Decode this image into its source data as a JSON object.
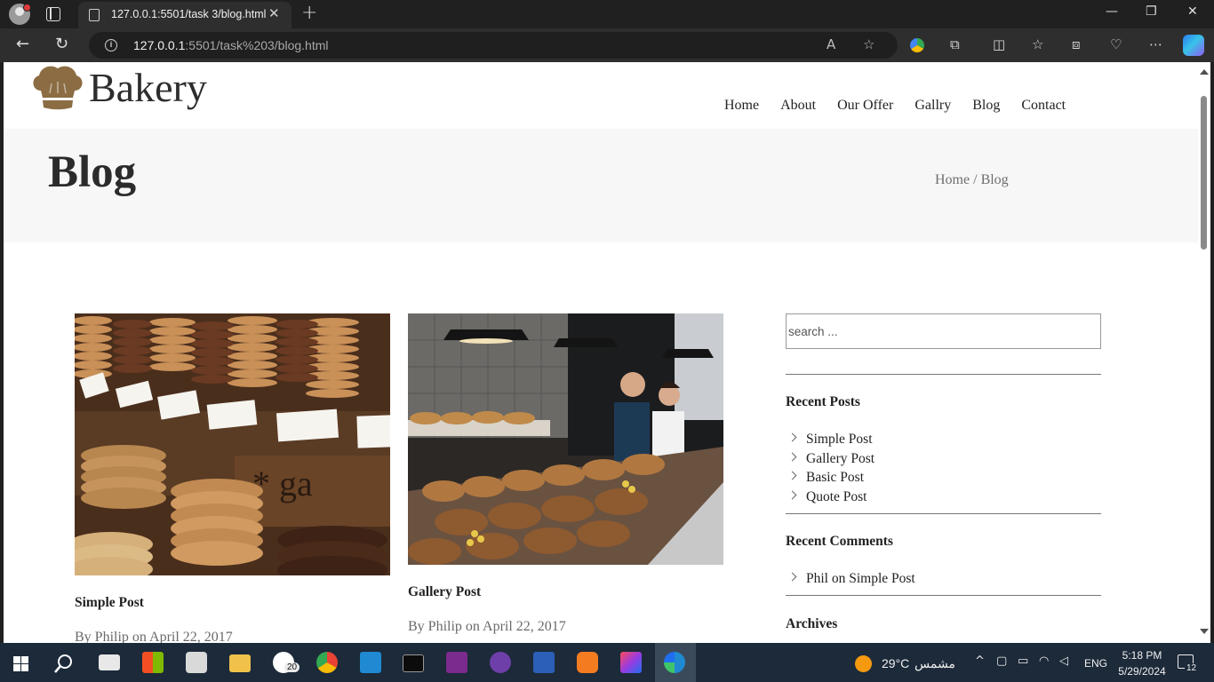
{
  "browser": {
    "tab_title": "127.0.0.1:5501/task 3/blog.html",
    "tab_close": "✕",
    "new_tab": "+",
    "url_host": "127.0.0.1",
    "url_rest": ":5501/task%203/blog.html",
    "window": {
      "minimize": "—",
      "maximize": "❐",
      "close": "✕"
    }
  },
  "site": {
    "logo_text": "Bakery",
    "nav": [
      "Home",
      "About",
      "Our Offer",
      "Gallry",
      "Blog",
      "Contact"
    ],
    "page_title": "Blog",
    "breadcrumb": {
      "home": "Home",
      "separator": " / ",
      "current": "Blog"
    },
    "posts": [
      {
        "title": "Simple Post",
        "meta": "By Philip on April 22, 2017"
      },
      {
        "title": "Gallery Post",
        "meta": "By Philip on April 22, 2017"
      }
    ],
    "sidebar": {
      "search_placeholder": "search ...",
      "recent_posts_title": "Recent Posts",
      "recent_posts": [
        "Simple Post",
        "Gallery Post",
        "Basic Post",
        "Quote Post"
      ],
      "recent_comments_title": "Recent Comments",
      "recent_comments": [
        "Phil on Simple Post"
      ],
      "archives_title": "Archives"
    },
    "colors": {
      "accent": "#8b6c43",
      "banner_bg": "#f7f7f7"
    }
  },
  "taskbar": {
    "apps": [
      "start-icon",
      "search-icon",
      "mail-icon",
      "store-icon",
      "camera-icon",
      "file-explorer-icon",
      "whatsapp-icon",
      "chrome-icon",
      "vscode-icon",
      "terminal-icon",
      "pdf-icon",
      "github-icon",
      "word-icon",
      "xampp-icon",
      "intellij-icon",
      "edge-icon"
    ],
    "whatsapp_badge": "20",
    "weather_temp": "29°C",
    "weather_label": "مشمس",
    "language": "ENG",
    "time": "5:18 PM",
    "date": "5/29/2024",
    "notification_count": "12"
  }
}
